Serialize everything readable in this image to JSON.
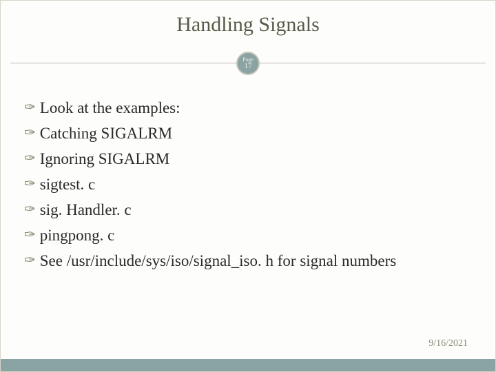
{
  "title": "Handling Signals",
  "page": {
    "label": "Page",
    "number": "17"
  },
  "bullets": [
    "Look at the examples:",
    "Catching SIGALRM",
    "Ignoring SIGALRM",
    "sigtest. c",
    "sig. Handler. c",
    "pingpong. c",
    "See /usr/include/sys/iso/signal_iso. h for signal numbers"
  ],
  "date": "9/16/2021"
}
